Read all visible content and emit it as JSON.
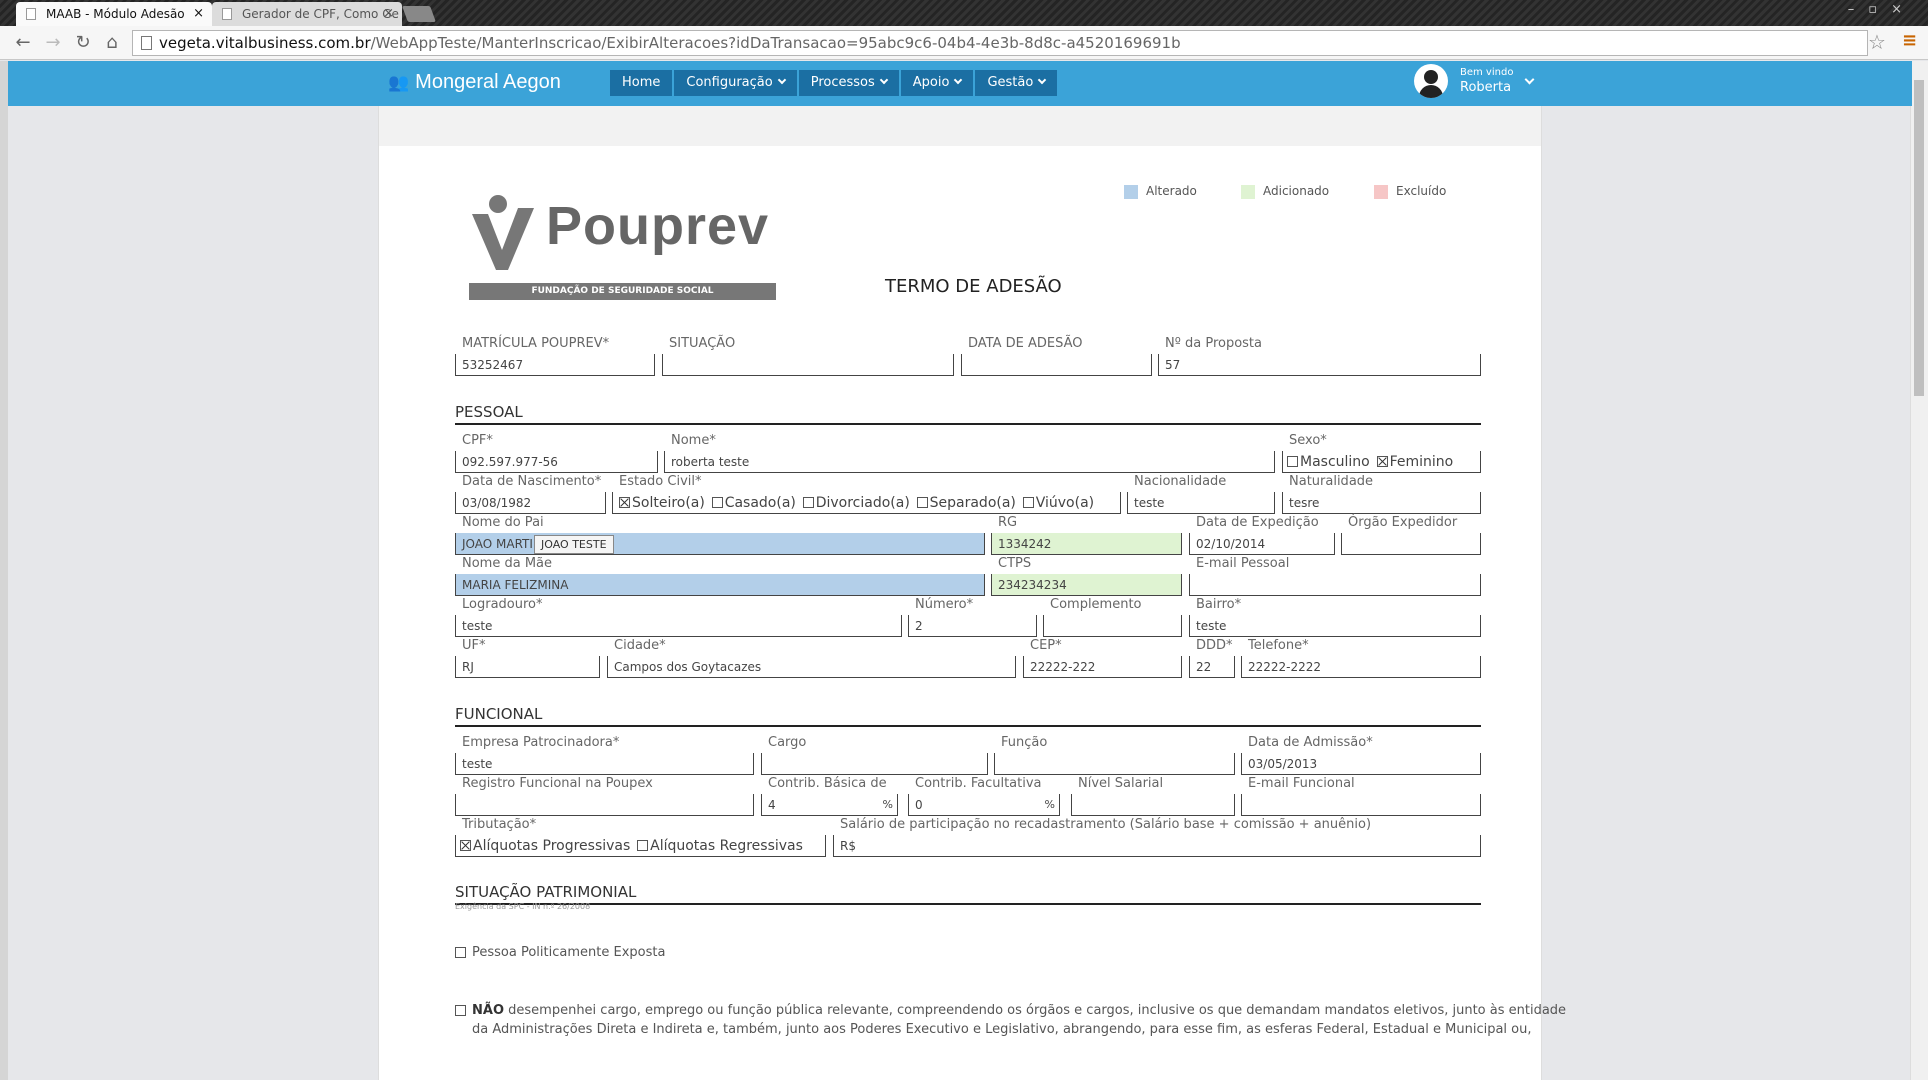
{
  "browser": {
    "tabs": [
      {
        "title": "MAAB - Módulo Adesão",
        "active": true
      },
      {
        "title": "Gerador de CPF, Como Ge",
        "active": false
      }
    ],
    "url_prefix": "vegeta.vitalbusiness.com.br",
    "url_path": "/WebAppTeste/ManterInscricao/ExibirAlteracoes?idDaTransacao=95abc9c6-04b4-4e3b-8d8c-a4520169691b"
  },
  "app": {
    "brand": "Mongeral Aegon",
    "nav": [
      "Home",
      "Configuração",
      "Processos",
      "Apoio",
      "Gestão"
    ],
    "user": {
      "greeting": "Bem vindo",
      "name": "Roberta"
    }
  },
  "legend": [
    {
      "label": "Alterado",
      "color": "#b3cfe9"
    },
    {
      "label": "Adicionado",
      "color": "#dff3d2"
    },
    {
      "label": "Excluído",
      "color": "#f6c6c6"
    }
  ],
  "logo": {
    "word": "Pouprev",
    "band": "FUNDAÇÃO DE SEGURIDADE SOCIAL"
  },
  "doc_title": "TERMO DE ADESÃO",
  "header": {
    "matricula": {
      "label": "MATRÍCULA POUPREV*",
      "value": "53252467"
    },
    "situacao": {
      "label": "SITUAÇÃO",
      "value": ""
    },
    "data_adesao": {
      "label": "DATA DE ADESÃO",
      "value": ""
    },
    "proposta": {
      "label": "Nº da Proposta",
      "value": "57"
    }
  },
  "sections": {
    "pessoal": "PESSOAL",
    "funcional": "FUNCIONAL",
    "patrimonial": "SITUAÇÃO PATRIMONIAL",
    "patrimonial_sub": "Exigência da SPC - IN n.º 26/2008"
  },
  "pessoal": {
    "cpf": {
      "label": "CPF*",
      "value": "092.597.977-56"
    },
    "nome": {
      "label": "Nome*",
      "value": "roberta teste"
    },
    "sexo": {
      "label": "Sexo*",
      "options": [
        "Masculino",
        "Feminino"
      ],
      "selected": "Feminino"
    },
    "nascimento": {
      "label": "Data de Nascimento*",
      "value": "03/08/1982"
    },
    "estado_civil": {
      "label": "Estado Civil*",
      "options": [
        "Solteiro(a)",
        "Casado(a)",
        "Divorciado(a)",
        "Separado(a)",
        "Viúvo(a)"
      ],
      "selected": "Solteiro(a)"
    },
    "nacionalidade": {
      "label": "Nacionalidade",
      "value": "teste"
    },
    "naturalidade": {
      "label": "Naturalidade",
      "value": "tesre"
    },
    "pai": {
      "label": "Nome do Pai",
      "value": "JOAO MARTINS",
      "tooltip": "JOAO TESTE"
    },
    "rg": {
      "label": "RG",
      "value": "1334242"
    },
    "expedicao": {
      "label": "Data de Expedição",
      "value": "02/10/2014"
    },
    "orgao": {
      "label": "Órgão Expedidor",
      "value": ""
    },
    "mae": {
      "label": "Nome da Mãe",
      "value": "MARIA FELIZMINA"
    },
    "ctps": {
      "label": "CTPS",
      "value": "234234234"
    },
    "email": {
      "label": "E-mail Pessoal",
      "value": ""
    },
    "logradouro": {
      "label": "Logradouro*",
      "value": "teste"
    },
    "numero": {
      "label": "Número*",
      "value": "2"
    },
    "complemento": {
      "label": "Complemento",
      "value": ""
    },
    "bairro": {
      "label": "Bairro*",
      "value": "teste"
    },
    "uf": {
      "label": "UF*",
      "value": "RJ"
    },
    "cidade": {
      "label": "Cidade*",
      "value": "Campos dos Goytacazes"
    },
    "cep": {
      "label": "CEP*",
      "value": "22222-222"
    },
    "ddd": {
      "label": "DDD*",
      "value": "22"
    },
    "telefone": {
      "label": "Telefone*",
      "value": "22222-2222"
    }
  },
  "funcional": {
    "empresa": {
      "label": "Empresa Patrocinadora*",
      "value": "teste"
    },
    "cargo": {
      "label": "Cargo",
      "value": ""
    },
    "funcao": {
      "label": "Função",
      "value": ""
    },
    "admissao": {
      "label": "Data de Admissão*",
      "value": "03/05/2013"
    },
    "registro": {
      "label": "Registro Funcional na Poupex",
      "value": ""
    },
    "contrib_basica": {
      "label": "Contrib. Básica de",
      "value": "4",
      "suffix": "%"
    },
    "contrib_facult": {
      "label": "Contrib. Facultativa",
      "value": "0",
      "suffix": "%"
    },
    "nivel": {
      "label": "Nível Salarial",
      "value": ""
    },
    "email_func": {
      "label": "E-mail Funcional",
      "value": ""
    },
    "tributacao": {
      "label": "Tributação*",
      "options": [
        "Alíquotas Progressivas",
        "Alíquotas Regressivas"
      ],
      "selected": "Alíquotas Progressivas"
    },
    "salario": {
      "label": "Salário de participação no recadastramento (Salário base + comissão + anuênio)",
      "value": "R$"
    }
  },
  "patrimonial": {
    "ppe": "Pessoa Politicamente Exposta",
    "nao_bold": "NÃO",
    "nao_line1": "desempenhei cargo, emprego ou função pública relevante, compreendendo os órgãos e cargos, inclusive os que demandam mandatos eletivos, junto às entidade",
    "nao_line2": "da Administrações Direta e Indireta e, também, junto aos Poderes Executivo e Legislativo, abrangendo, para esse fim, as esferas Federal, Estadual e Municipal ou,"
  }
}
